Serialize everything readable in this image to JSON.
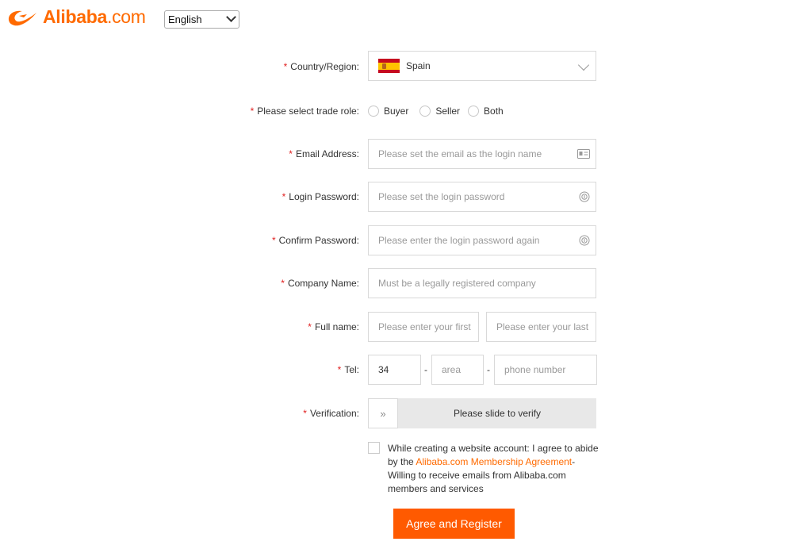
{
  "header": {
    "logo_text": "Alibaba",
    "logo_suffix": ".com",
    "language": "English"
  },
  "colors": {
    "brand": "#ff6a00",
    "button": "#ff5a00",
    "required_star": "#e02020"
  },
  "form": {
    "required_mark": "*",
    "country": {
      "label": "Country/Region:",
      "value": "Spain",
      "flag_icon": "spain-flag-icon"
    },
    "trade_role": {
      "label": "Please select trade role:",
      "options": [
        "Buyer",
        "Seller",
        "Both"
      ]
    },
    "email": {
      "label": "Email Address:",
      "placeholder": "Please set the email as the login name"
    },
    "password": {
      "label": "Login Password:",
      "placeholder": "Please set the login password"
    },
    "confirm_password": {
      "label": "Confirm Password:",
      "placeholder": "Please enter the login password again"
    },
    "company": {
      "label": "Company Name:",
      "placeholder": "Must be a legally registered company"
    },
    "full_name": {
      "label": "Full name:",
      "first_placeholder": "Please enter your first",
      "last_placeholder": "Please enter your last"
    },
    "tel": {
      "label": "Tel:",
      "country_code": "34",
      "area_placeholder": "area",
      "number_placeholder": "phone number",
      "separator": "-"
    },
    "verification": {
      "label": "Verification:",
      "slider_text": "Please slide to verify",
      "handle_glyph": "»"
    },
    "agreement": {
      "text_before": "While creating a website account: I agree to abide by the ",
      "link_text": "Alibaba.com Membership Agreement",
      "text_after": "- Willing to receive emails from Alibaba.com members and services"
    },
    "submit_label": "Agree and Register"
  }
}
